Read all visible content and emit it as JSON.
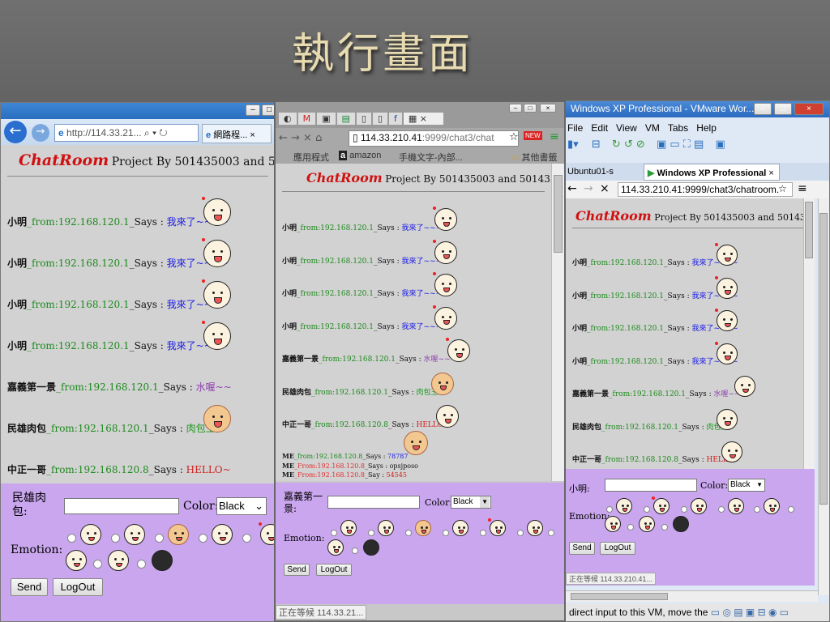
{
  "slide_title": "執行畫面",
  "chat_logo": "ChatRoom",
  "chat_project": "Project By 501435003 and 501435011",
  "win1": {
    "url": "http://114.33.21...",
    "tab_label": "網路程...",
    "project_visible": "Project By 501435003 and 50143501",
    "messages": [
      {
        "name": "小明",
        "from": "_from:192.168.120.1",
        "says": "_Says :",
        "text": "我來了~~~~",
        "color": "blue"
      },
      {
        "name": "小明",
        "from": "_from:192.168.120.1",
        "says": "_Says :",
        "text": "我來了~~~~",
        "color": "blue"
      },
      {
        "name": "小明",
        "from": "_from:192.168.120.1",
        "says": "_Says :",
        "text": "我來了~~~~",
        "color": "blue"
      },
      {
        "name": "小明",
        "from": "_from:192.168.120.1",
        "says": "_Says :",
        "text": "我來了~~~~",
        "color": "blue"
      },
      {
        "name": "嘉義第一景",
        "from": "_from:192.168.120.1",
        "says": "_Says :",
        "text": "水喔~~",
        "color": "purple"
      },
      {
        "name": "民雄肉包",
        "from": "_from:192.168.120.1",
        "says": "_Says :",
        "text": "肉包王",
        "color": "green"
      },
      {
        "name": "中正一哥",
        "from": "_from:192.168.120.8",
        "says": "_Says :",
        "text": "HELLO~",
        "color": "red"
      }
    ],
    "username": "民雄肉包:",
    "color_label": "Color:",
    "color_value": "Black",
    "emotion_label": "Emotion:",
    "send_label": "Send",
    "logout_label": "LogOut"
  },
  "win2": {
    "url_prefix": "114.33.210.41",
    "url_rest": ":9999/chat3/chat",
    "bookmarks": [
      "應用程式",
      "amazon",
      "手機文字-內部...",
      "其他書籤"
    ],
    "messages": [
      {
        "name": "小明",
        "from": "_from:192.168.120.1",
        "says": "_Says :",
        "text": "我來了~~~~",
        "color": "blue"
      },
      {
        "name": "小明",
        "from": "_from:192.168.120.1",
        "says": "_Says :",
        "text": "我來了~~~~",
        "color": "blue"
      },
      {
        "name": "小明",
        "from": "_from:192.168.120.1",
        "says": "_Says :",
        "text": "我來了~~~~",
        "color": "blue"
      },
      {
        "name": "小明",
        "from": "_from:192.168.120.1",
        "says": "_Says :",
        "text": "我來了~~~~",
        "color": "blue"
      },
      {
        "name": "嘉義第一景",
        "from": "_from:192.168.120.1",
        "says": "_Says :",
        "text": "水喔~~",
        "color": "purple"
      },
      {
        "name": "民雄肉包",
        "from": "_from:192.168.120.1",
        "says": "_Says :",
        "text": "肉包王",
        "color": "green"
      },
      {
        "name": "中正一哥",
        "from": "_from:192.168.120.8",
        "says": "_Says :",
        "text": "HELLO~",
        "color": "red"
      }
    ],
    "me_lines": [
      {
        "name": "ME",
        "from": "_from:192.168.120.8",
        "says": "_Says :",
        "text": "78787",
        "color": "blue",
        "from_color": "green"
      },
      {
        "name": "ME",
        "from": "_From:192.168.120.8",
        "says": "_Says :",
        "text": "opsjposo",
        "color": "black",
        "from_color": "red"
      },
      {
        "name": "ME",
        "from": "_From:192.168.120.8",
        "says": "_Say :",
        "text": "54545",
        "color": "red",
        "from_color": "red"
      }
    ],
    "username": "嘉義第一景:",
    "color_label": "Color:",
    "color_value": "Black",
    "emotion_label": "Emotion:",
    "send_label": "Send",
    "logout_label": "LogOut",
    "status": "正在等候 114.33.21..."
  },
  "win3": {
    "title": "Windows XP Professional - VMware Wor...",
    "menu": [
      "File",
      "Edit",
      "View",
      "VM",
      "Tabs",
      "Help"
    ],
    "tabs": [
      "Ubuntu01-s",
      "Windows XP Professional"
    ],
    "url": "114.33.210.41:9999/chat3/chatroom.",
    "messages": [
      {
        "name": "小明",
        "from": "_from:192.168.120.1",
        "says": "_Says :",
        "text": "我來了~~~~",
        "color": "blue"
      },
      {
        "name": "小明",
        "from": "_from:192.168.120.1",
        "says": "_Says :",
        "text": "我來了~~~~",
        "color": "blue"
      },
      {
        "name": "小明",
        "from": "_from:192.168.120.1",
        "says": "_Says :",
        "text": "我來了~~~~",
        "color": "blue"
      },
      {
        "name": "小明",
        "from": "_from:192.168.120.1",
        "says": "_Says :",
        "text": "我來了~~~~",
        "color": "blue"
      },
      {
        "name": "嘉義第一景",
        "from": "_from:192.168.120.1",
        "says": "_Says :",
        "text": "水喔~~",
        "color": "purple"
      },
      {
        "name": "民雄肉包",
        "from": "_from:192.168.120.1",
        "says": "_Says :",
        "text": "肉包王",
        "color": "green"
      },
      {
        "name": "中正一哥",
        "from": "_from:192.168.120.8",
        "says": "_Says :",
        "text": "HELLO~",
        "color": "red"
      }
    ],
    "username": "小明:",
    "color_label": "Color:",
    "color_value": "Black",
    "emotion_label": "Emotion:",
    "send_label": "Send",
    "logout_label": "LogOut",
    "status": "正在等候 114.33.210.41...",
    "vm_status": "direct input to this VM, move the"
  },
  "colors": {
    "panel": "#c9a6ee",
    "logo": "#d01010",
    "from": "#1c8a1c",
    "blue": "#1a1ae6",
    "purple": "#9040b0",
    "green": "#1a9a1a",
    "red": "#d02020"
  }
}
